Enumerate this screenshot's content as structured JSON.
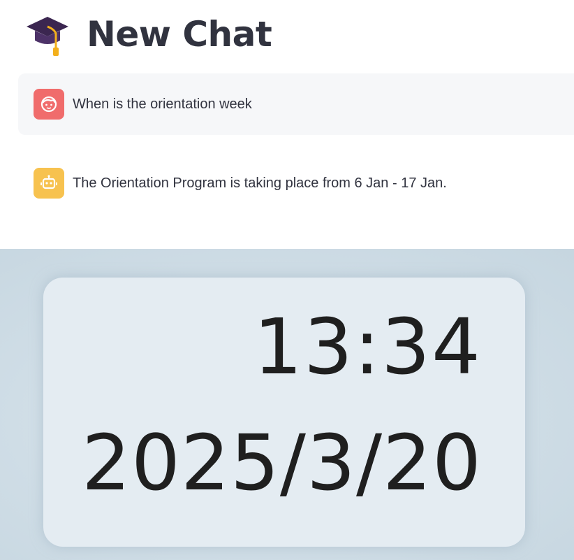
{
  "page": {
    "title": "New Chat",
    "title_icon": "graduation-cap-icon"
  },
  "chat": {
    "messages": [
      {
        "role": "user",
        "avatar_icon": "user-face-icon",
        "avatar_color": "#f06c6c",
        "text": "When is the orientation week"
      },
      {
        "role": "assistant",
        "avatar_icon": "robot-icon",
        "avatar_color": "#f7c24f",
        "text": "The Orientation Program is taking place from 6 Jan - 17 Jan."
      }
    ]
  },
  "clock": {
    "time": "13:34",
    "date": "2025/3/20"
  }
}
